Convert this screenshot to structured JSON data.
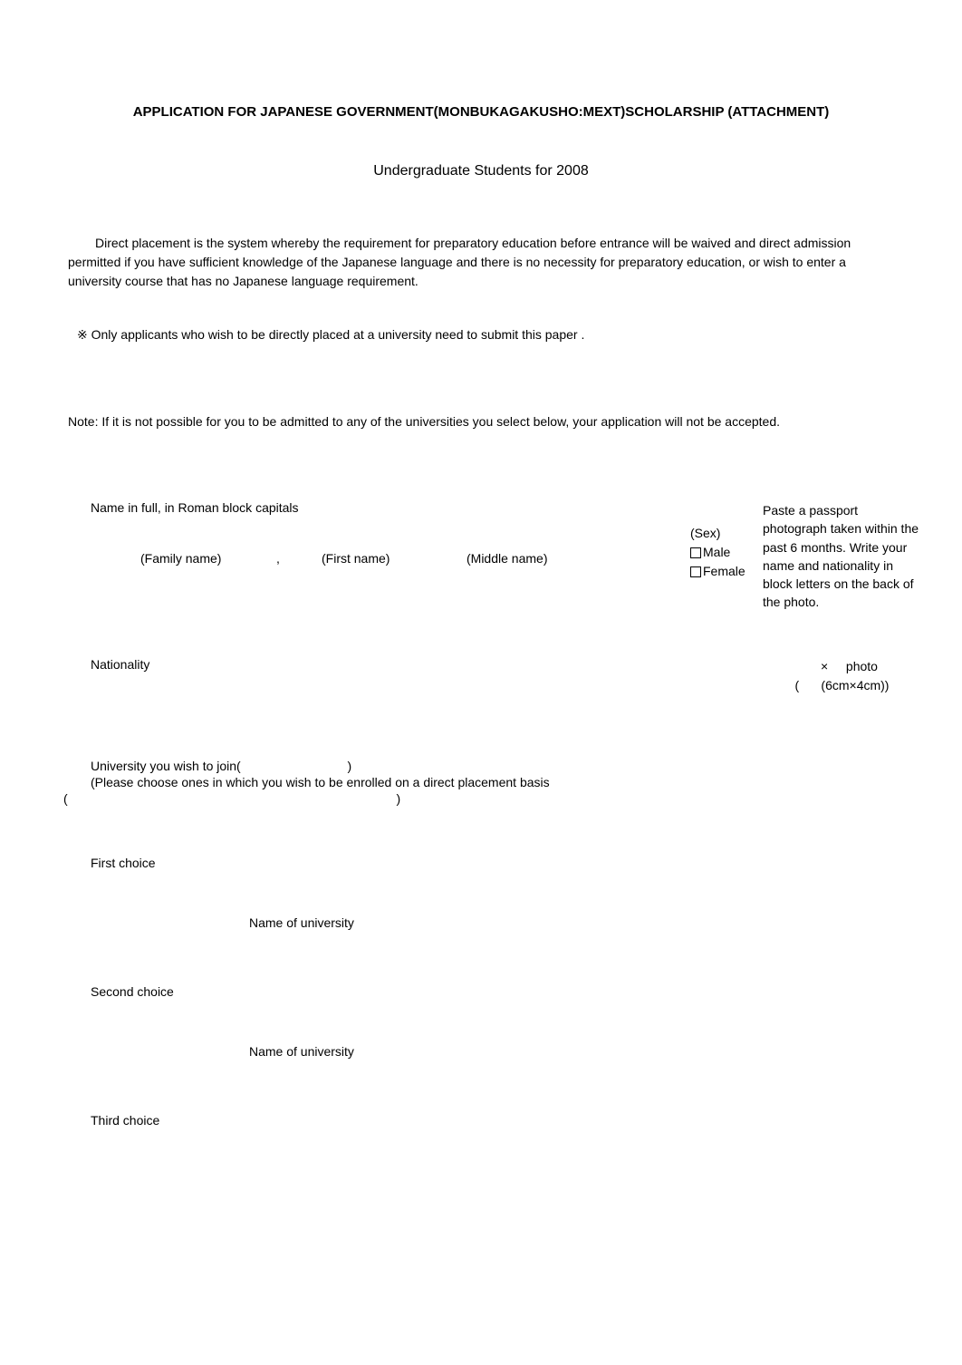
{
  "title": "APPLICATION FOR JAPANESE GOVERNMENT(MONBUKAGAKUSHO:MEXT)SCHOLARSHIP (ATTACHMENT)",
  "subtitle_prefix": "Undergraduate Students for 2008",
  "description": "Direct placement is the system whereby the requirement for preparatory education before entrance will be waived and direct admission permitted if you have sufficient knowledge of the Japanese language and there is no necessity for preparatory education, or wish to enter a university course that has no Japanese language requirement.",
  "submit_note": "※ Only applicants who wish to be directly placed at a university need to submit this paper .",
  "accept_note": "Note: If it is not possible for you to be admitted to any of the universities you select below, your application will not be accepted.",
  "name_label": "Name in full, in Roman block capitals",
  "name_parts": {
    "family": "(Family name)",
    "comma": ",",
    "first": "(First name)",
    "middle": "(Middle name)"
  },
  "sex": {
    "label": "(Sex)",
    "male": "Male",
    "female": "Female"
  },
  "photo": {
    "instructions": "Paste a passport photograph taken within the past 6 months. Write your name and nationality in block letters on the back of the photo.",
    "cross": "×",
    "word": "photo",
    "paren_open": "(",
    "dims": "(6cm×4cm))"
  },
  "nationality_label": "Nationality",
  "university": {
    "label": "University you wish to join(",
    "label_close": ")",
    "instruction": "(Please choose ones in which you wish to be enrolled on a direct placement basis",
    "paren_open": "(",
    "paren_close": ")"
  },
  "choices": {
    "first": {
      "label": "First choice",
      "uni": "Name of university"
    },
    "second": {
      "label": "Second choice",
      "uni": "Name of university"
    },
    "third": {
      "label": "Third choice"
    }
  }
}
